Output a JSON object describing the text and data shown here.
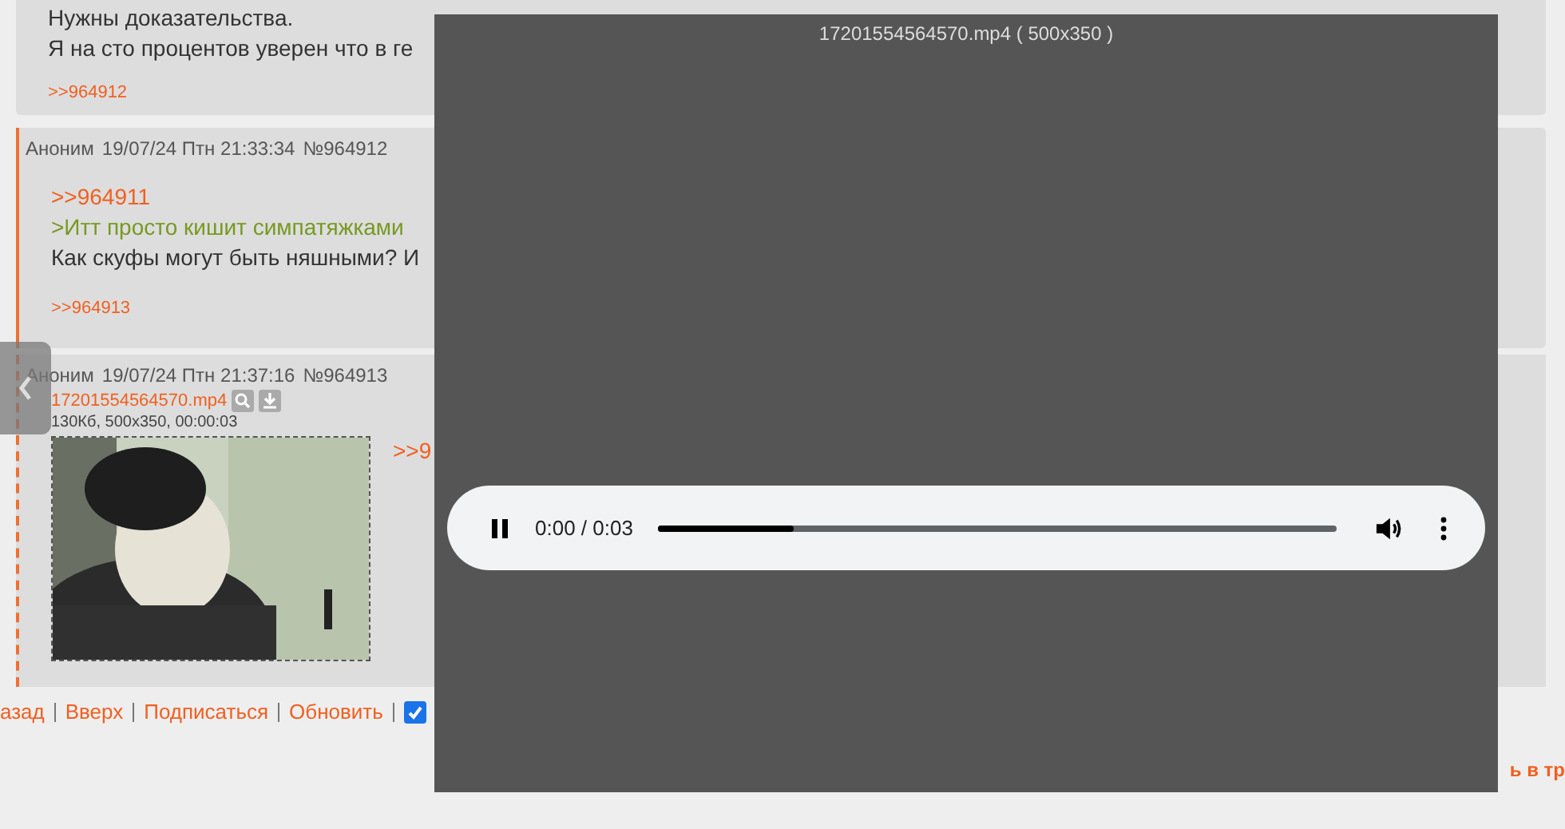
{
  "posts": [
    {
      "lines": [
        {
          "kind": "text",
          "text": "Нужны доказательства."
        },
        {
          "kind": "text",
          "text": "Я на сто процентов уверен что в ге"
        }
      ],
      "replies": [
        ">>964912"
      ]
    },
    {
      "header": {
        "name": "Аноним",
        "date": "19/07/24 Птн 21:33:34",
        "number": "№964912"
      },
      "lines": [
        {
          "kind": "link",
          "text": ">>964911"
        },
        {
          "kind": "quote",
          "text": ">Итт просто кишит симпатяжками"
        },
        {
          "kind": "text",
          "text": "Как скуфы могут быть няшными? И"
        }
      ],
      "replies": [
        ">>964913"
      ]
    },
    {
      "header": {
        "name": "Аноним",
        "date": "19/07/24 Птн 21:37:16",
        "number": "№964913"
      },
      "file": {
        "name": "17201554564570.mp4",
        "info": "130Кб, 500x350, 00:00:03"
      },
      "lines": [
        {
          "kind": "link",
          "text": ">>9"
        }
      ]
    }
  ],
  "footer_links": [
    "азад",
    "Вверх",
    "Подписаться",
    "Обновить"
  ],
  "auto_update": {
    "checked": true
  },
  "bottom_link": "ь в тр",
  "viewer": {
    "title": "17201554564570.mp4 ( 500x350 )",
    "player": {
      "playing": true,
      "time": "0:00 / 0:03",
      "level": 0.2
    }
  }
}
